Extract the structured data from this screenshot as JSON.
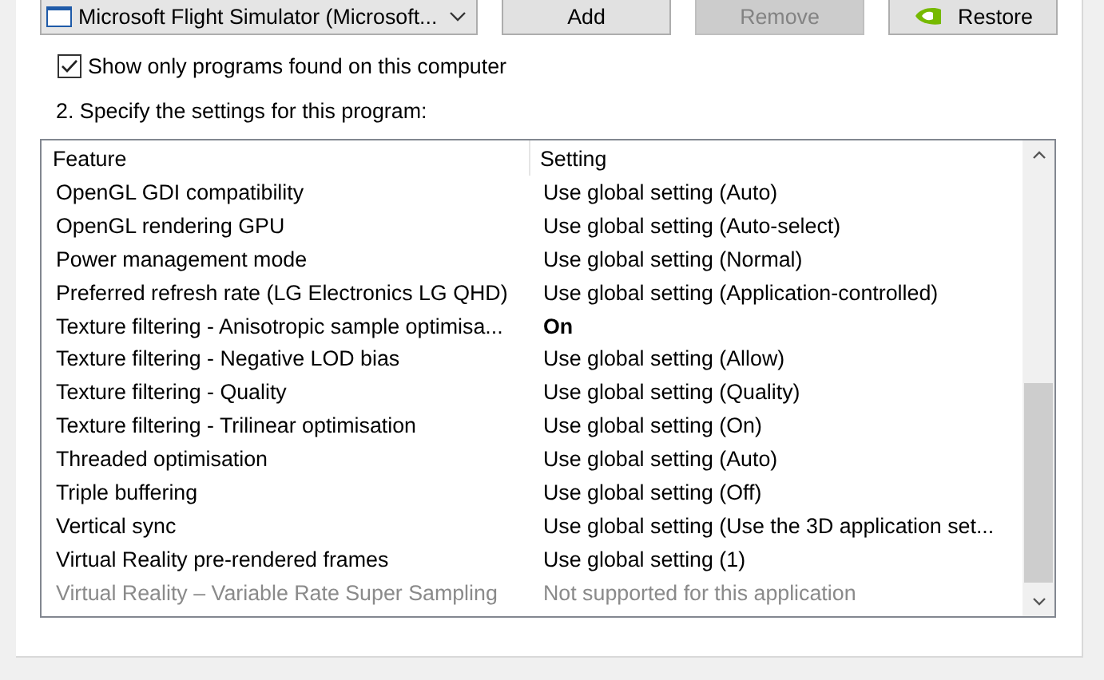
{
  "program_select": {
    "value": "Microsoft Flight Simulator (Microsoft..."
  },
  "buttons": [
    {
      "label": "Add",
      "disabled": false,
      "kind": "plain"
    },
    {
      "label": "Remove",
      "disabled": true,
      "kind": "plain"
    },
    {
      "label": "Restore",
      "disabled": false,
      "kind": "logo"
    }
  ],
  "show_only_found": {
    "label": "Show only programs found on this computer",
    "checked": true
  },
  "section_label": "2. Specify the settings for this program:",
  "table": {
    "columns": [
      "Feature",
      "Setting"
    ],
    "rows": [
      {
        "feature": "OpenGL GDI compatibility",
        "setting": "Use global setting (Auto)",
        "kind": "global"
      },
      {
        "feature": "OpenGL rendering GPU",
        "setting": "Use global setting (Auto-select)",
        "kind": "global"
      },
      {
        "feature": "Power management mode",
        "setting": "Use global setting (Normal)",
        "kind": "global"
      },
      {
        "feature": "Preferred refresh rate (LG Electronics LG QHD)",
        "setting": "Use global setting (Application-controlled)",
        "kind": "global"
      },
      {
        "feature": "Texture filtering - Anisotropic sample optimisa...",
        "setting": "On",
        "kind": "custom"
      },
      {
        "feature": "Texture filtering - Negative LOD bias",
        "setting": "Use global setting (Allow)",
        "kind": "global"
      },
      {
        "feature": "Texture filtering - Quality",
        "setting": "Use global setting (Quality)",
        "kind": "global"
      },
      {
        "feature": "Texture filtering - Trilinear optimisation",
        "setting": "Use global setting (On)",
        "kind": "global"
      },
      {
        "feature": "Threaded optimisation",
        "setting": "Use global setting (Auto)",
        "kind": "global"
      },
      {
        "feature": "Triple buffering",
        "setting": "Use global setting (Off)",
        "kind": "global"
      },
      {
        "feature": "Vertical sync",
        "setting": "Use global setting (Use the 3D application set...",
        "kind": "global"
      },
      {
        "feature": "Virtual Reality pre-rendered frames",
        "setting": "Use global setting (1)",
        "kind": "global"
      },
      {
        "feature": "Virtual Reality – Variable Rate Super Sampling",
        "setting": "Not supported for this application",
        "kind": "unsupported"
      }
    ]
  }
}
